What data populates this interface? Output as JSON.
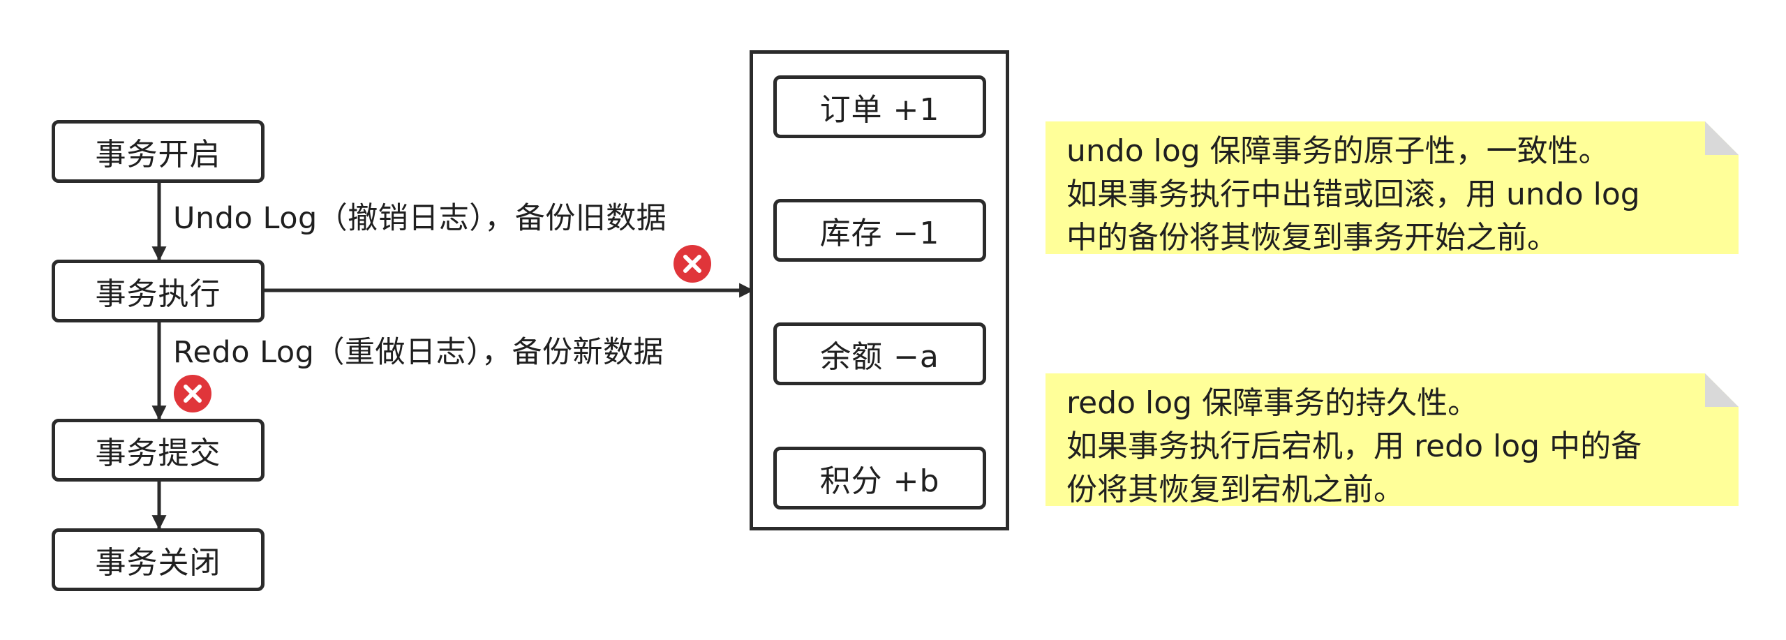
{
  "flow": {
    "start": "事务开启",
    "execute": "事务执行",
    "commit": "事务提交",
    "close": "事务关闭",
    "undo_label": "Undo Log（撤销日志），备份旧数据",
    "redo_label": "Redo Log（重做日志），备份新数据"
  },
  "operations": {
    "order": "订单 +1",
    "stock": "库存 −1",
    "balance": "余额 −a",
    "points": "积分 +b"
  },
  "notes": {
    "undo": {
      "line1": "undo log 保障事务的原子性，一致性。",
      "line2": "如果事务执行中出错或回滚，用 undo log",
      "line3": "中的备份将其恢复到事务开始之前。"
    },
    "redo": {
      "line1": "redo log 保障事务的持久性。",
      "line2": "如果事务执行后宕机，用 redo log 中的备",
      "line3": "份将其恢复到宕机之前。"
    }
  },
  "colors": {
    "stroke": "#2b2b2b",
    "note_fill": "#ffff99",
    "note_fold": "#d9d9d9",
    "error": "#e0353a"
  },
  "icons": {
    "error": "error-x-circle-icon"
  }
}
